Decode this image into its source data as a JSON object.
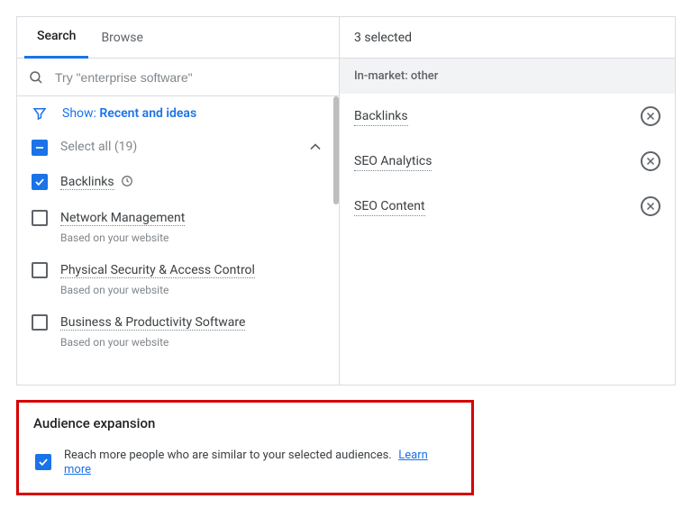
{
  "tabs": {
    "search": "Search",
    "browse": "Browse"
  },
  "search": {
    "placeholder": "Try \"enterprise software\""
  },
  "filter": {
    "show_prefix": "Show: ",
    "show_value": "Recent and ideas"
  },
  "select_all": {
    "label": "Select all (19)"
  },
  "items": [
    {
      "title": "Backlinks",
      "sub": "",
      "checked": true,
      "recent": true
    },
    {
      "title": "Network Management",
      "sub": "Based on your website",
      "checked": false,
      "recent": false
    },
    {
      "title": "Physical Security & Access Control",
      "sub": "Based on your website",
      "checked": false,
      "recent": false
    },
    {
      "title": "Business & Productivity Software",
      "sub": "Based on your website",
      "checked": false,
      "recent": false
    }
  ],
  "selected": {
    "count_label": "3 selected",
    "category": "In-market: other",
    "items": [
      {
        "title": "Backlinks"
      },
      {
        "title": "SEO Analytics"
      },
      {
        "title": "SEO Content"
      }
    ]
  },
  "expansion": {
    "title": "Audience expansion",
    "text": "Reach more people who are similar to your selected audiences.",
    "learn_more": "Learn more"
  }
}
